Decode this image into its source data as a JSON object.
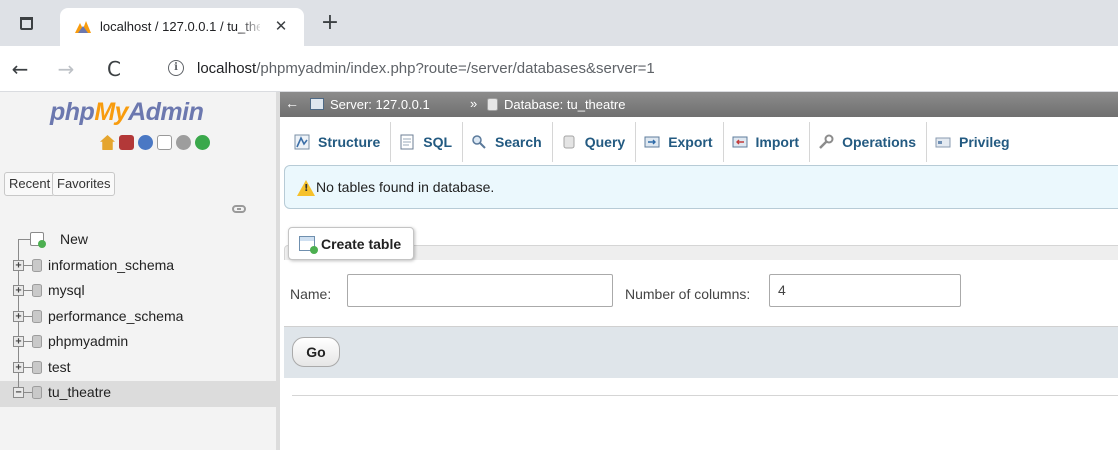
{
  "browser": {
    "tab_title": "localhost / 127.0.0.1 / tu_theatre",
    "tab_close": "✕",
    "new_tab": "+",
    "url_host": "localhost",
    "url_path": "/phpmyadmin/index.php?route=/server/databases&server=1",
    "back": "←",
    "forward": "→",
    "reload": "C",
    "info": "i"
  },
  "sidebar": {
    "logo_php": "php",
    "logo_my": "My",
    "logo_admin": "Admin",
    "recent_label": "Recent",
    "favorites_label": "Favorites",
    "new_label": "New",
    "databases": [
      {
        "name": "information_schema",
        "expander": "+"
      },
      {
        "name": "mysql",
        "expander": "+"
      },
      {
        "name": "performance_schema",
        "expander": "+"
      },
      {
        "name": "phpmyadmin",
        "expander": "+"
      },
      {
        "name": "test",
        "expander": "+"
      },
      {
        "name": "tu_theatre",
        "expander": "−",
        "selected": true
      }
    ]
  },
  "breadcrumb": {
    "arrow": "←",
    "server": "Server: 127.0.0.1",
    "separator": "»",
    "database": "Database: tu_theatre"
  },
  "tabs": [
    {
      "label": "Structure",
      "icon": "structure-icon",
      "active": true
    },
    {
      "label": "SQL",
      "icon": "sql-icon"
    },
    {
      "label": "Search",
      "icon": "search-icon"
    },
    {
      "label": "Query",
      "icon": "query-icon"
    },
    {
      "label": "Export",
      "icon": "export-icon"
    },
    {
      "label": "Import",
      "icon": "import-icon"
    },
    {
      "label": "Operations",
      "icon": "operations-icon"
    },
    {
      "label": "Privileg",
      "icon": "privileges-icon"
    }
  ],
  "notice": {
    "text": "No tables found in database."
  },
  "create_table": {
    "legend": "Create table",
    "name_label": "Name:",
    "name_value": "",
    "columns_label": "Number of columns:",
    "columns_value": "4",
    "go_label": "Go"
  },
  "colors": {
    "tab_text": "#235a81",
    "logo_blue": "#6c78af",
    "logo_orange": "#f89c0e",
    "notice_bg": "#ebf8fd"
  }
}
